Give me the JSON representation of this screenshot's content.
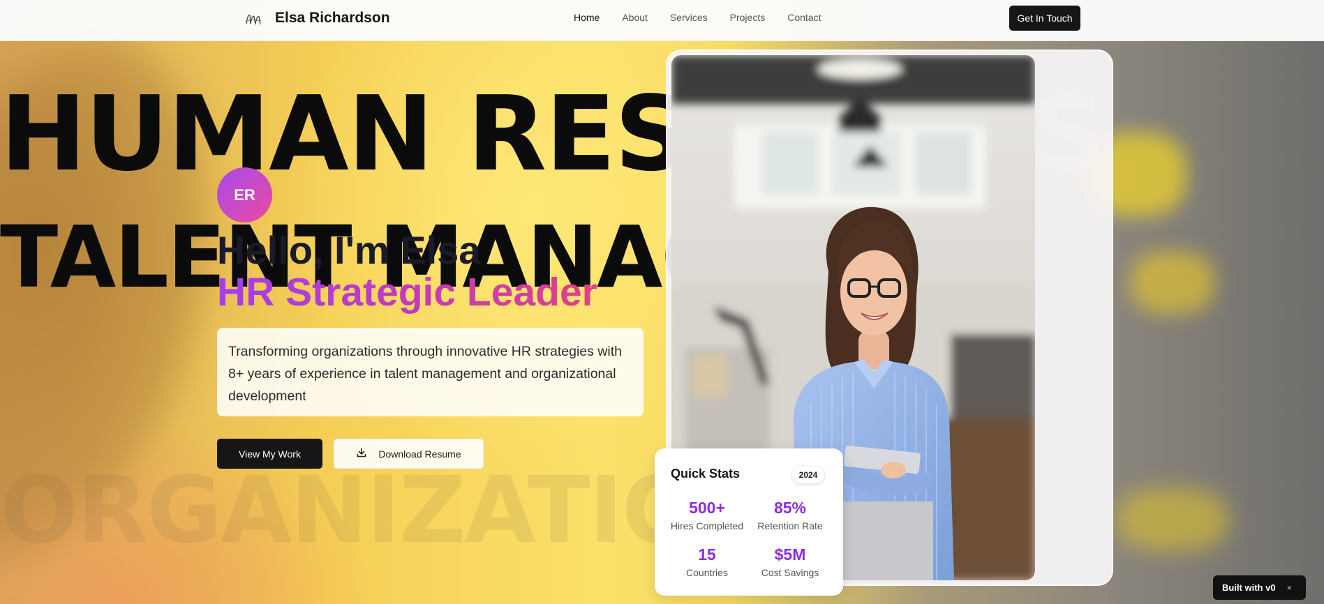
{
  "nav": {
    "brand": "Elsa Richardson",
    "links": [
      {
        "label": "Home",
        "active": true
      },
      {
        "label": "About"
      },
      {
        "label": "Services"
      },
      {
        "label": "Projects"
      },
      {
        "label": "Contact"
      }
    ],
    "cta": "Get In Touch"
  },
  "background_words": [
    "HUMAN RESOURCES",
    "TALENT MANAGEMENT",
    "ORGANIZATIONAL DEVELOPMENT"
  ],
  "background_word_1_visible_fragment": "HUMAN RESO",
  "background_word_1_ghost": "S",
  "background_word_2_visible_fragment": "TALENT MANAGE",
  "background_word_3_visible_fragment": "ORGANIZATIO",
  "hero": {
    "initials": "ER",
    "greeting": "Hello, I'm Elsa",
    "role": "HR Strategic Leader",
    "description": "Transforming organizations through innovative HR strategies with 8+ years of experience in talent management and organizational development",
    "primary_button": "View My Work",
    "secondary_button": "Download Resume"
  },
  "stats": {
    "title": "Quick Stats",
    "year": "2024",
    "items": [
      {
        "value": "500+",
        "label": "Hires Completed"
      },
      {
        "value": "85%",
        "label": "Retention Rate"
      },
      {
        "value": "15",
        "label": "Countries"
      },
      {
        "value": "$5M",
        "label": "Cost Savings"
      }
    ]
  },
  "badge": {
    "label": "Built with v0",
    "close": "×"
  },
  "colors": {
    "accent_purple": "#8a2ee0",
    "gradient_start": "#a23ef0",
    "gradient_end": "#e0408a",
    "dark": "#161616"
  }
}
